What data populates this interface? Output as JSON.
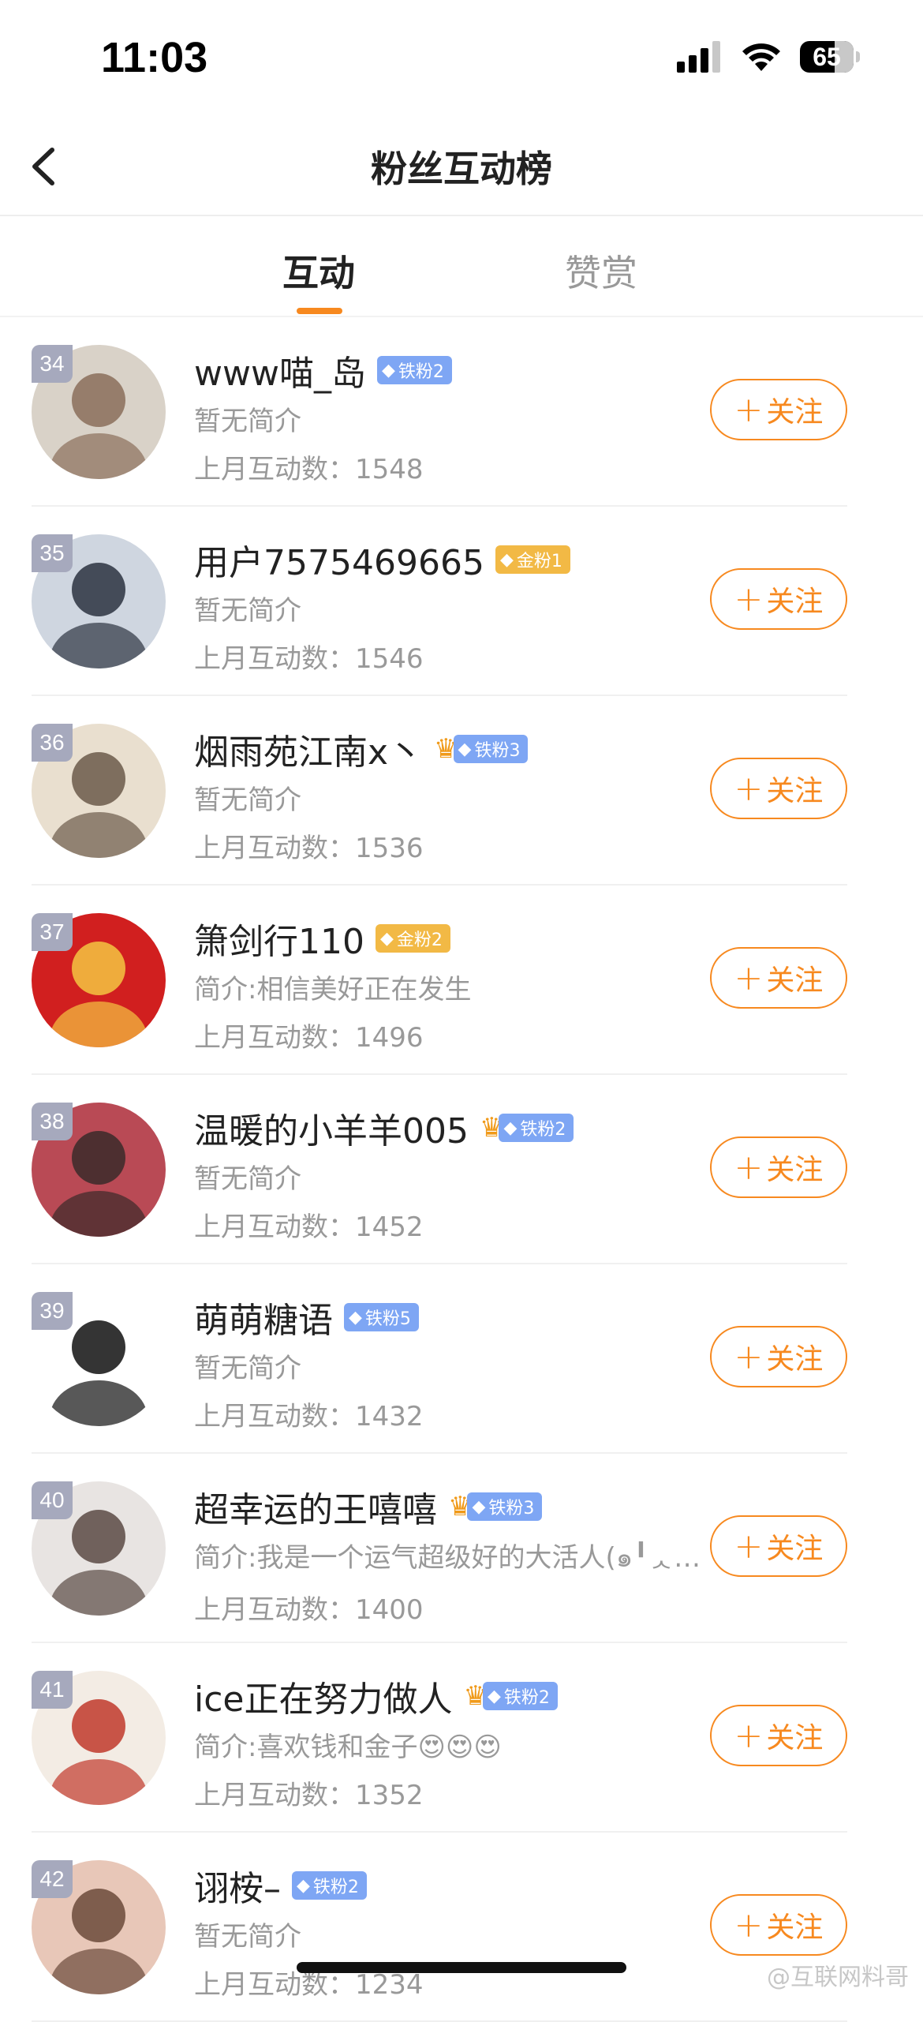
{
  "status_bar": {
    "time": "11:03",
    "battery": "65",
    "battery_level": 0.65
  },
  "header": {
    "title": "粉丝互动榜"
  },
  "tabs": [
    {
      "label": "互动",
      "active": true
    },
    {
      "label": "赞赏",
      "active": false
    }
  ],
  "follow_label": "关注",
  "fans": [
    {
      "rank": "34",
      "name": "www喵_岛",
      "badge": "铁粉2",
      "badge_type": "blue",
      "crown": false,
      "bio": "暂无简介",
      "count_label": "上月互动数：",
      "count": "1548",
      "avatar_colors": [
        "#d9d2c8",
        "#8a6e5a"
      ]
    },
    {
      "rank": "35",
      "name": "用户7575469665",
      "badge": "金粉1",
      "badge_type": "gold",
      "crown": false,
      "bio": "暂无简介",
      "count_label": "上月互动数：",
      "count": "1546",
      "avatar_colors": [
        "#cfd6e0",
        "#2c3340"
      ]
    },
    {
      "rank": "36",
      "name": "烟雨苑江南x丶",
      "badge": "铁粉3",
      "badge_type": "blue",
      "crown": true,
      "bio": "暂无简介",
      "count_label": "上月互动数：",
      "count": "1536",
      "avatar_colors": [
        "#e9dfcf",
        "#6b5a4a"
      ]
    },
    {
      "rank": "37",
      "name": "箫剑行110",
      "badge": "金粉2",
      "badge_type": "gold",
      "crown": false,
      "bio": "简介:相信美好正在发生",
      "count_label": "上月互动数：",
      "count": "1496",
      "avatar_colors": [
        "#d11f1f",
        "#f5c542"
      ]
    },
    {
      "rank": "38",
      "name": "温暖的小羊羊005",
      "badge": "铁粉2",
      "badge_type": "blue",
      "crown": true,
      "bio": "暂无简介",
      "count_label": "上月互动数：",
      "count": "1452",
      "avatar_colors": [
        "#b94a55",
        "#3a2a2a"
      ]
    },
    {
      "rank": "39",
      "name": "萌萌糖语",
      "badge": "铁粉5",
      "badge_type": "blue",
      "crown": false,
      "bio": "暂无简介",
      "count_label": "上月互动数：",
      "count": "1432",
      "avatar_colors": [
        "#ffffff",
        "#111111"
      ]
    },
    {
      "rank": "40",
      "name": "超幸运的王嘻嘻",
      "badge": "铁粉3",
      "badge_type": "blue",
      "crown": true,
      "bio": "简介:我是一个运气超级好的大活人(๑╹ᆺ╹)…",
      "count_label": "上月互动数：",
      "count": "1400",
      "avatar_colors": [
        "#e8e4e2",
        "#5a4a44"
      ]
    },
    {
      "rank": "41",
      "name": "ice正在努力做人",
      "badge": "铁粉2",
      "badge_type": "blue",
      "crown": true,
      "bio": "简介:喜欢钱和金子😍😍😍",
      "count_label": "上月互动数：",
      "count": "1352",
      "avatar_colors": [
        "#f3ece4",
        "#c0392b"
      ]
    },
    {
      "rank": "42",
      "name": "诩桉–",
      "badge": "铁粉2",
      "badge_type": "blue",
      "crown": false,
      "bio": "暂无简介",
      "count_label": "上月互动数：",
      "count": "1234",
      "avatar_colors": [
        "#e8c7b8",
        "#6b4a3a"
      ]
    }
  ],
  "watermark": "@互联网料哥"
}
